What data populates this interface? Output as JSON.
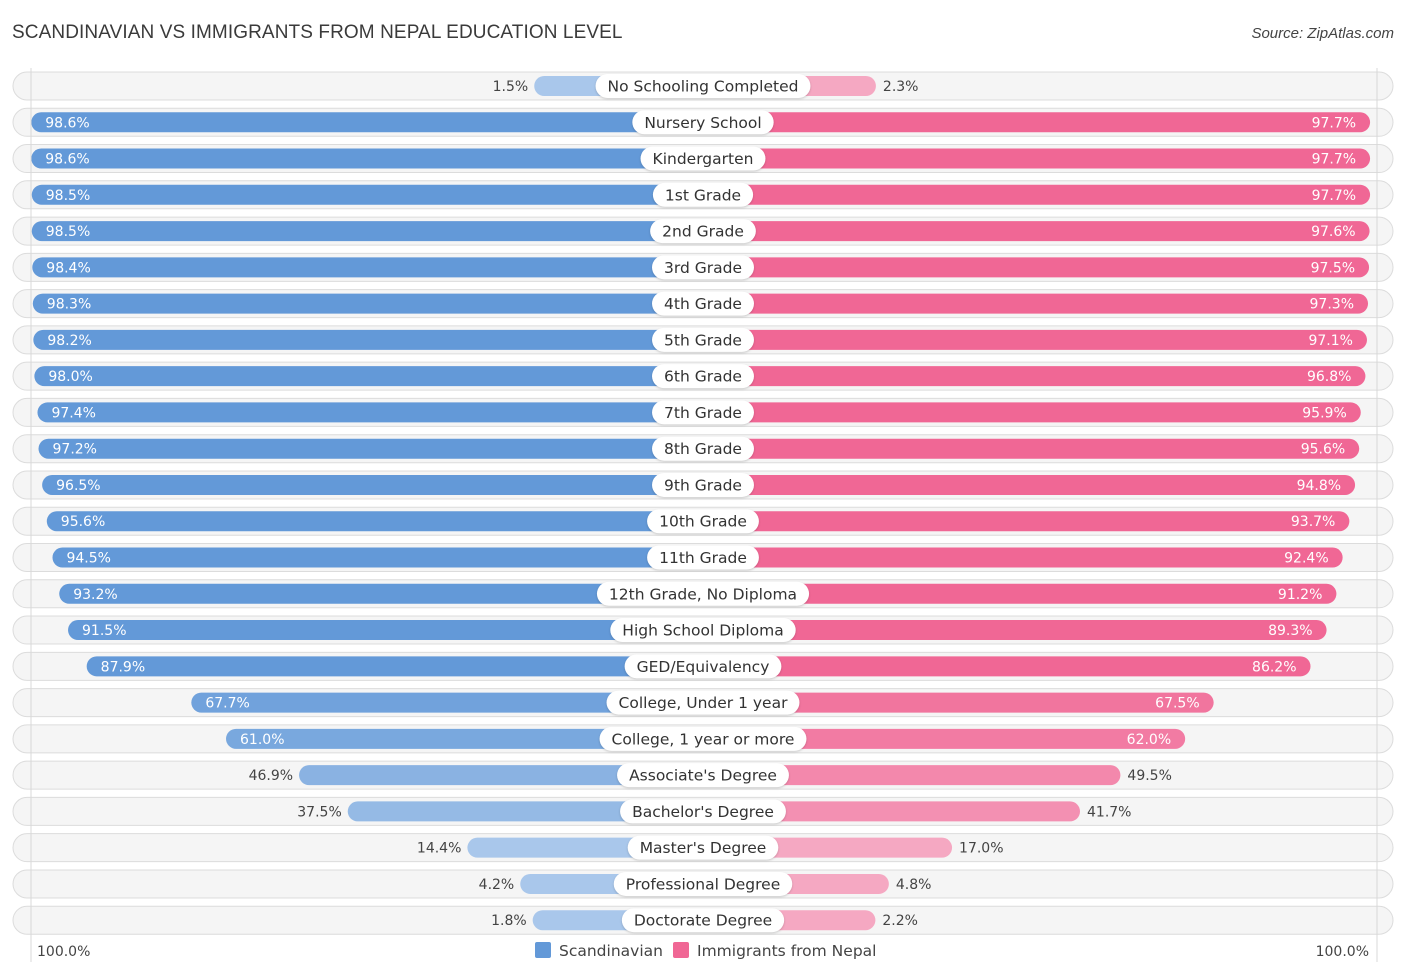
{
  "header": {
    "title": "SCANDINAVIAN VS IMMIGRANTS FROM NEPAL EDUCATION LEVEL",
    "source": "Source: ZipAtlas.com"
  },
  "chart_data": {
    "type": "bar",
    "orientation": "horizontal-diverging",
    "title": "SCANDINAVIAN VS IMMIGRANTS FROM NEPAL EDUCATION LEVEL",
    "categories": [
      "No Schooling Completed",
      "Nursery School",
      "Kindergarten",
      "1st Grade",
      "2nd Grade",
      "3rd Grade",
      "4th Grade",
      "5th Grade",
      "6th Grade",
      "7th Grade",
      "8th Grade",
      "9th Grade",
      "10th Grade",
      "11th Grade",
      "12th Grade, No Diploma",
      "High School Diploma",
      "GED/Equivalency",
      "College, Under 1 year",
      "College, 1 year or more",
      "Associate's Degree",
      "Bachelor's Degree",
      "Master's Degree",
      "Professional Degree",
      "Doctorate Degree"
    ],
    "series": [
      {
        "name": "Scandinavian",
        "color": "#6399d8",
        "color_light": "#a9c7eb",
        "values": [
          1.5,
          98.6,
          98.6,
          98.5,
          98.5,
          98.4,
          98.3,
          98.2,
          98.0,
          97.4,
          97.2,
          96.5,
          95.6,
          94.5,
          93.2,
          91.5,
          87.9,
          67.7,
          61.0,
          46.9,
          37.5,
          14.4,
          4.2,
          1.8
        ]
      },
      {
        "name": "Immigrants from Nepal",
        "color": "#f06795",
        "color_light": "#f5a8c2",
        "values": [
          2.3,
          97.7,
          97.7,
          97.7,
          97.6,
          97.5,
          97.3,
          97.1,
          96.8,
          95.9,
          95.6,
          94.8,
          93.7,
          92.4,
          91.2,
          89.3,
          86.2,
          67.5,
          62.0,
          49.5,
          41.7,
          17.0,
          4.8,
          2.2
        ]
      }
    ],
    "value_suffix": "%",
    "axis": {
      "left_label": "100.0%",
      "right_label": "100.0%",
      "range": [
        0,
        100
      ]
    },
    "legend": {
      "position": "bottom-center",
      "entries": [
        "Scandinavian",
        "Immigrants from Nepal"
      ]
    },
    "grid": false
  }
}
